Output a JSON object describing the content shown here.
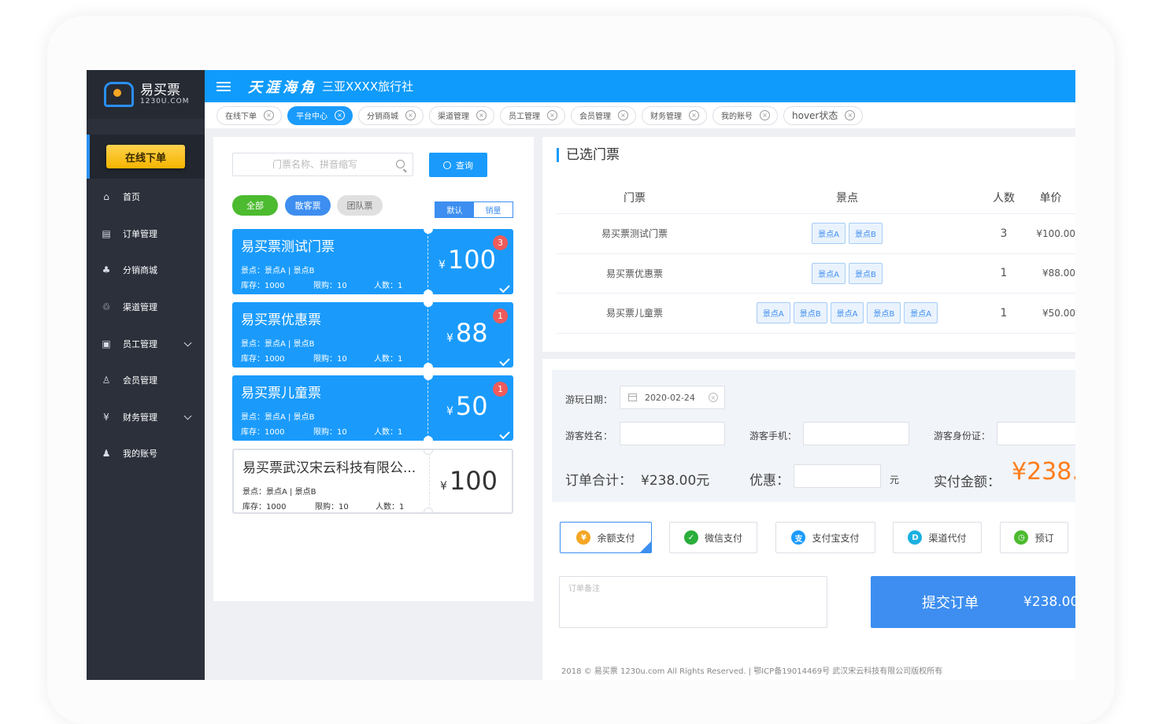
{
  "sidebar": {
    "logo_cn": "易买票",
    "logo_en": "1230U.COM",
    "order_button": "在线下单",
    "items": [
      {
        "label": "首页",
        "icon": "home-icon",
        "glyph": "⌂",
        "has_arrow": false
      },
      {
        "label": "订单管理",
        "icon": "order-icon",
        "glyph": "▤",
        "has_arrow": false
      },
      {
        "label": "分销商城",
        "icon": "distribution-icon",
        "glyph": "♣",
        "has_arrow": false
      },
      {
        "label": "渠道管理",
        "icon": "channel-icon",
        "glyph": "♲",
        "has_arrow": false
      },
      {
        "label": "员工管理",
        "icon": "staff-icon",
        "glyph": "▣",
        "has_arrow": true
      },
      {
        "label": "会员管理",
        "icon": "member-icon",
        "glyph": "♙",
        "has_arrow": false
      },
      {
        "label": "财务管理",
        "icon": "finance-icon",
        "glyph": "¥",
        "has_arrow": true
      },
      {
        "label": "我的账号",
        "icon": "account-icon",
        "glyph": "♟",
        "has_arrow": false
      }
    ]
  },
  "header": {
    "brand_calligraphy": "天涯海角",
    "agency_name": "三亚XXXX旅行社"
  },
  "tabs": [
    {
      "label": "在线下单",
      "active": false
    },
    {
      "label": "平台中心",
      "active": true
    },
    {
      "label": "分销商城",
      "active": false
    },
    {
      "label": "渠道管理",
      "active": false
    },
    {
      "label": "员工管理",
      "active": false
    },
    {
      "label": "会员管理",
      "active": false
    },
    {
      "label": "财务管理",
      "active": false
    },
    {
      "label": "我的账号",
      "active": false
    },
    {
      "label": "hover状态",
      "active": false
    }
  ],
  "search": {
    "placeholder": "门票名称、拼音缩写",
    "button": "查询"
  },
  "filters": {
    "all": "全部",
    "scatter": "散客票",
    "team": "团队票",
    "sort_default": "默认",
    "sort_sales": "销量"
  },
  "tickets": [
    {
      "name": "易买票测试门票",
      "spots": "景点：景点A | 景点B",
      "stock": "库存：1000",
      "limit": "限购：10",
      "count": "人数：1",
      "yen": "¥",
      "price": "100",
      "badge": "3",
      "selected": true
    },
    {
      "name": "易买票优惠票",
      "spots": "景点：景点A | 景点B",
      "stock": "库存：1000",
      "limit": "限购：10",
      "count": "人数：1",
      "yen": "¥",
      "price": "88",
      "badge": "1",
      "selected": true
    },
    {
      "name": "易买票儿童票",
      "spots": "景点：景点A | 景点B",
      "stock": "库存：1000",
      "limit": "限购：10",
      "count": "人数：1",
      "yen": "¥",
      "price": "50",
      "badge": "1",
      "selected": true
    },
    {
      "name": "易买票武汉宋云科技有限公...",
      "spots": "景点：景点A | 景点B",
      "stock": "库存：1000",
      "limit": "限购：10",
      "count": "人数：1",
      "yen": "¥",
      "price": "100",
      "badge": "",
      "selected": false
    }
  ],
  "selected": {
    "title": "已选门票",
    "headers": [
      "门票",
      "景点",
      "人数",
      "单价"
    ],
    "rows": [
      {
        "ticket": "易买票测试门票",
        "spots": [
          "景点A",
          "景点B"
        ],
        "count": "3",
        "price": "¥100.00"
      },
      {
        "ticket": "易买票优惠票",
        "spots": [
          "景点A",
          "景点B"
        ],
        "count": "1",
        "price": "¥88.00"
      },
      {
        "ticket": "易买票儿童票",
        "spots": [
          "景点A",
          "景点B",
          "景点A",
          "景点B",
          "景点A"
        ],
        "count": "1",
        "price": "¥50.00"
      }
    ]
  },
  "form": {
    "date_label": "游玩日期：",
    "date_value": "2020-02-24",
    "name_label": "游客姓名：",
    "phone_label": "游客手机：",
    "id_label": "游客身份证：",
    "total_label": "订单合计：",
    "total_value": "¥238.00元",
    "discount_label": "优惠：",
    "discount_unit": "元",
    "actual_label": "实付金额：",
    "actual_value": "¥238."
  },
  "payments": [
    {
      "label": "余额支付",
      "icon": "wallet-icon",
      "glyph": "¥",
      "color": "#f5a623",
      "active": true
    },
    {
      "label": "微信支付",
      "icon": "wechat-icon",
      "glyph": "✓",
      "color": "#2aae3a",
      "active": false
    },
    {
      "label": "支付宝支付",
      "icon": "alipay-icon",
      "glyph": "支",
      "color": "#1a9bfc",
      "active": false
    },
    {
      "label": "渠道代付",
      "icon": "channel-pay-icon",
      "glyph": "D",
      "color": "#1ab0e0",
      "active": false
    },
    {
      "label": "预订",
      "icon": "clock-icon",
      "glyph": "◷",
      "color": "#4cbb2f",
      "active": false
    }
  ],
  "remark_placeholder": "订单备注",
  "submit": {
    "label": "提交订单",
    "amount": "¥238.00"
  },
  "footer": "2018 © 易买票 1230u.com All Rights Reserved. | 鄂ICP备19014469号 武汉宋云科技有限公司版权所有",
  "colors": {
    "primary": "#1a9bfc",
    "accent": "#ff7d1a",
    "sidebar": "#2b303b",
    "success": "#4cbb2f"
  }
}
